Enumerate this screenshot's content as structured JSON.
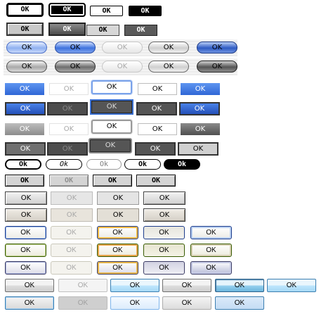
{
  "gallery": {
    "rows": [
      {
        "name": "classic-black-row",
        "buttons": [
          {
            "label": "OK",
            "state": "normal"
          },
          {
            "label": "OK",
            "state": "pressed"
          },
          {
            "label": "OK",
            "state": "flat"
          },
          {
            "label": "OK",
            "state": "dark"
          }
        ]
      },
      {
        "name": "classic-gray-row",
        "buttons": [
          {
            "label": "OK",
            "state": "normal"
          },
          {
            "label": "OK",
            "state": "pressed"
          },
          {
            "label": "OK",
            "state": "flat"
          },
          {
            "label": "OK",
            "state": "dark"
          }
        ]
      },
      {
        "name": "pill-blue-row",
        "buttons": [
          {
            "label": "OK",
            "state": "normal"
          },
          {
            "label": "OK",
            "state": "hover"
          },
          {
            "label": "OK",
            "state": "disabled"
          },
          {
            "label": "OK",
            "state": "silver"
          },
          {
            "label": "OK",
            "state": "pressed"
          }
        ]
      },
      {
        "name": "pill-gray-row",
        "buttons": [
          {
            "label": "OK",
            "state": "normal"
          },
          {
            "label": "OK",
            "state": "hover"
          },
          {
            "label": "OK",
            "state": "disabled"
          },
          {
            "label": "OK",
            "state": "silver"
          },
          {
            "label": "OK",
            "state": "pressed"
          }
        ]
      },
      {
        "name": "flat-blue-row",
        "buttons": [
          {
            "label": "OK",
            "state": "normal"
          },
          {
            "label": "OK",
            "state": "disabled"
          },
          {
            "label": "OK",
            "state": "focused"
          },
          {
            "label": "OK",
            "state": "white"
          },
          {
            "label": "OK",
            "state": "blue"
          }
        ]
      },
      {
        "name": "dark-blue-row",
        "buttons": [
          {
            "label": "OK",
            "state": "normal"
          },
          {
            "label": "OK",
            "state": "disabled"
          },
          {
            "label": "OK",
            "state": "focused"
          },
          {
            "label": "OK",
            "state": "dark"
          },
          {
            "label": "OK",
            "state": "blue"
          }
        ]
      },
      {
        "name": "flat-gray-row",
        "buttons": [
          {
            "label": "OK",
            "state": "normal"
          },
          {
            "label": "OK",
            "state": "disabled"
          },
          {
            "label": "OK",
            "state": "focused"
          },
          {
            "label": "OK",
            "state": "white"
          },
          {
            "label": "OK",
            "state": "dark"
          }
        ]
      },
      {
        "name": "dark-gray-row",
        "buttons": [
          {
            "label": "OK",
            "state": "normal"
          },
          {
            "label": "OK",
            "state": "disabled"
          },
          {
            "label": "OK",
            "state": "focused"
          },
          {
            "label": "OK",
            "state": "dark"
          },
          {
            "label": "OK",
            "state": "light"
          }
        ]
      },
      {
        "name": "rounded-mono-row",
        "buttons": [
          {
            "label": "Ok",
            "state": "normal"
          },
          {
            "label": "Ok",
            "state": "italic"
          },
          {
            "label": "Ok",
            "state": "disabled"
          },
          {
            "label": "Ok",
            "state": "normal"
          },
          {
            "label": "Ok",
            "state": "black"
          }
        ]
      },
      {
        "name": "gray-bevel-row",
        "buttons": [
          {
            "label": "OK",
            "state": "normal"
          },
          {
            "label": "OK",
            "state": "disabled"
          },
          {
            "label": "OK",
            "state": "normal"
          },
          {
            "label": "OK",
            "state": "normal"
          }
        ]
      },
      {
        "name": "silver-bevel-row",
        "buttons": [
          {
            "label": "OK",
            "state": "normal"
          },
          {
            "label": "OK",
            "state": "disabled"
          },
          {
            "label": "OK",
            "state": "normal"
          },
          {
            "label": "OK",
            "state": "normal"
          }
        ]
      },
      {
        "name": "beige-bevel-row",
        "buttons": [
          {
            "label": "OK",
            "state": "normal"
          },
          {
            "label": "OK",
            "state": "disabled"
          },
          {
            "label": "OK",
            "state": "normal"
          },
          {
            "label": "OK",
            "state": "normal"
          }
        ]
      },
      {
        "name": "xp-blue-row",
        "buttons": [
          {
            "label": "OK",
            "state": "normal"
          },
          {
            "label": "OK",
            "state": "disabled"
          },
          {
            "label": "OK",
            "state": "hover"
          },
          {
            "label": "OK",
            "state": "pressed"
          },
          {
            "label": "OK",
            "state": "default"
          }
        ]
      },
      {
        "name": "xp-olive-row",
        "buttons": [
          {
            "label": "OK",
            "state": "normal"
          },
          {
            "label": "OK",
            "state": "disabled"
          },
          {
            "label": "OK",
            "state": "hover"
          },
          {
            "label": "OK",
            "state": "pressed"
          },
          {
            "label": "OK",
            "state": "default"
          }
        ]
      },
      {
        "name": "xp-silver-row",
        "buttons": [
          {
            "label": "OK",
            "state": "normal"
          },
          {
            "label": "OK",
            "state": "disabled"
          },
          {
            "label": "OK",
            "state": "hover"
          },
          {
            "label": "OK",
            "state": "pressed"
          },
          {
            "label": "OK",
            "state": "default"
          }
        ]
      },
      {
        "name": "vista-row",
        "buttons": [
          {
            "label": "OK",
            "state": "normal"
          },
          {
            "label": "OK",
            "state": "disabled"
          },
          {
            "label": "OK",
            "state": "hover"
          },
          {
            "label": "OK",
            "state": "normal"
          },
          {
            "label": "OK",
            "state": "pressed"
          },
          {
            "label": "OK",
            "state": "hover"
          }
        ]
      },
      {
        "name": "win7-row",
        "buttons": [
          {
            "label": "OK",
            "state": "normal"
          },
          {
            "label": "OK",
            "state": "disabled"
          },
          {
            "label": "OK",
            "state": "hover"
          },
          {
            "label": "OK",
            "state": "normal"
          },
          {
            "label": "OK",
            "state": "pressed"
          }
        ]
      }
    ]
  },
  "colors": {
    "accent_blue": "#3c78e6",
    "dark_gray": "#555555",
    "disabled_text": "#a8a8a8"
  }
}
